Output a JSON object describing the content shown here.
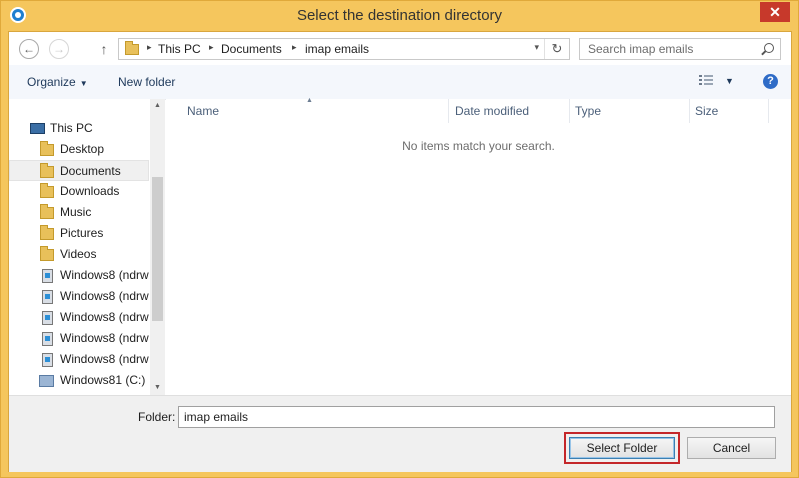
{
  "window": {
    "title": "Select the destination directory",
    "close_glyph": "✕"
  },
  "nav": {
    "back_glyph": "←",
    "forward_glyph": "→",
    "up_glyph": "↑",
    "breadcrumbs": [
      "This PC",
      "Documents",
      "imap emails"
    ],
    "separator": "▸",
    "refresh_glyph": "↻",
    "dropdown_glyph": "▾"
  },
  "search": {
    "placeholder": "Search imap emails"
  },
  "toolbar": {
    "organize": "Organize",
    "new_folder": "New folder",
    "help": "?"
  },
  "tree": {
    "items": [
      {
        "label": "This PC",
        "icon": "pc-icon"
      },
      {
        "label": "Desktop",
        "icon": "folder-icon"
      },
      {
        "label": "Documents",
        "icon": "folder-icon",
        "selected": true
      },
      {
        "label": "Downloads",
        "icon": "folder-icon"
      },
      {
        "label": "Music",
        "icon": "folder-icon"
      },
      {
        "label": "Pictures",
        "icon": "folder-icon"
      },
      {
        "label": "Videos",
        "icon": "folder-icon"
      },
      {
        "label": "Windows8 (ndrw",
        "icon": "network-drive-icon"
      },
      {
        "label": "Windows8 (ndrw",
        "icon": "network-drive-icon"
      },
      {
        "label": "Windows8 (ndrw",
        "icon": "network-drive-icon"
      },
      {
        "label": "Windows8 (ndrw",
        "icon": "network-drive-icon"
      },
      {
        "label": "Windows8 (ndrw",
        "icon": "network-drive-icon"
      },
      {
        "label": "Windows81 (C:)",
        "icon": "windows-drive-icon"
      }
    ]
  },
  "columns": [
    "Name",
    "Date modified",
    "Type",
    "Size"
  ],
  "empty_message": "No items match your search.",
  "footer": {
    "folder_label": "Folder:",
    "folder_value": "imap emails",
    "select_button": "Select Folder",
    "cancel_button": "Cancel"
  },
  "colors": {
    "frame": "#f5c65d",
    "close": "#c7392b",
    "highlight": "#c4272a",
    "link": "#1e395b"
  }
}
